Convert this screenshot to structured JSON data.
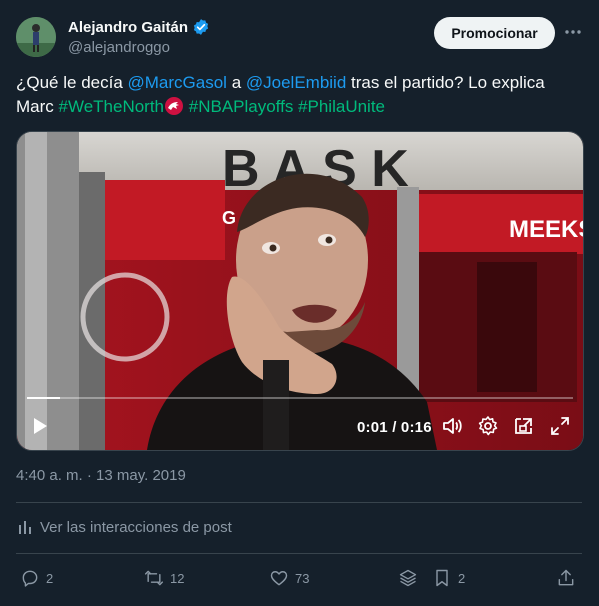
{
  "author": {
    "display_name": "Alejandro Gaitán",
    "handle": "@alejandroggo"
  },
  "header": {
    "promote_label": "Promocionar"
  },
  "tweet": {
    "text_1": "¿Qué le decía ",
    "mention_1": "@MarcGasol",
    "text_2": " a ",
    "mention_2": "@JoelEmbiid",
    "text_3": " tras el partido? Lo explica Marc ",
    "hashtag_1": "#WeTheNorth",
    "hashtag_2": "#NBAPlayoffs",
    "hashtag_3": "#PhilaUnite"
  },
  "video": {
    "time_display": "0:01 / 0:16",
    "progress": 0.06,
    "sign_text_top": "B A S K",
    "sign_text_meeks": "MEEKS",
    "sign_text_left": "G"
  },
  "meta": {
    "timestamp": "4:40 a. m. · 13 may. 2019",
    "analytics_label": "Ver las interacciones de post"
  },
  "actions": {
    "replies": "2",
    "retweets": "12",
    "likes": "73",
    "bookmarks": "2"
  },
  "colors": {
    "background": "#15202b",
    "mention": "#1d9bf0",
    "hashtag": "#00ba7c",
    "muted": "#8b98a5"
  }
}
